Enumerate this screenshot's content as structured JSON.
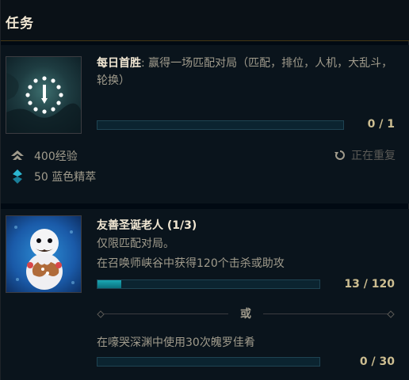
{
  "header": {
    "title": "任务"
  },
  "quests": [
    {
      "title": "每日首胜",
      "description": ": 赢得一场匹配对局（匹配，排位，人机，大乱斗，轮换）",
      "progress_text": "0 / 1",
      "progress_fraction": 0,
      "icon": "first-win-emblem-icon",
      "rewards": [
        {
          "icon": "experience-icon",
          "label": "400经验"
        },
        {
          "icon": "blue-essence-icon",
          "label": "50 蓝色精萃"
        }
      ],
      "repeat_label": "正在重复"
    },
    {
      "title": "友善圣诞老人 (1/3)",
      "restriction": "仅限匹配对局。",
      "objectives": [
        {
          "label": "在召唤师峡谷中获得120个击杀或助攻",
          "progress_text": "13 / 120",
          "progress_fraction": 0.108
        },
        {
          "label": "在嚎哭深渊中使用30次魄罗佳肴",
          "progress_text": "0 / 30",
          "progress_fraction": 0
        }
      ],
      "separator": "或",
      "icon": "gingerbread-snowman-icon"
    }
  ],
  "colors": {
    "accent_gold": "#cdbe91",
    "bar_fill": "#0ea5b3",
    "background": "#010a13"
  }
}
